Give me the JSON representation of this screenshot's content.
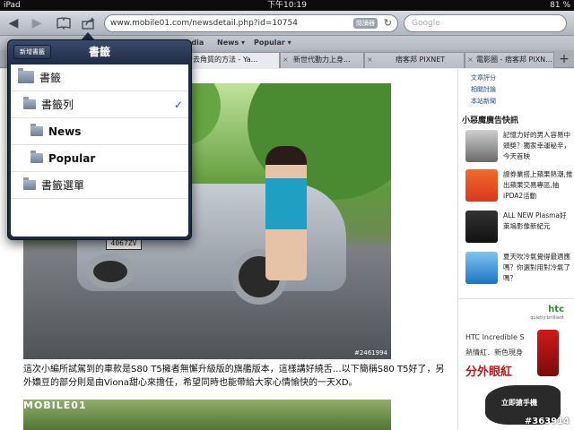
{
  "status": {
    "device": "iPad",
    "time": "下午10:19",
    "battery": "81 %"
  },
  "toolbar": {
    "back_icon": "back-arrow-icon",
    "forward_icon": "forward-arrow-icon",
    "bookmarks_icon": "book-icon",
    "share_icon": "share-icon",
    "url": "www.mobile01.com/newsdetail.php?id=10754",
    "reader_label": "閱讀器",
    "search_placeholder": "Google"
  },
  "bookmarks_bar": {
    "items": [
      "edia",
      "News ▾",
      "Popular ▾"
    ]
  },
  "tabs": [
    {
      "label": "去角質的方法 - Ya..."
    },
    {
      "label": "新世代動力上身..."
    },
    {
      "label": "痞客邦 PIXNET"
    },
    {
      "label": "電影圈 - 痞客邦 PIXN..."
    }
  ],
  "tab_add": "+",
  "popover": {
    "title": "書籤",
    "new_button": "新增書籤",
    "items": [
      {
        "label": "書籤",
        "checked": false
      },
      {
        "label": "書籤列",
        "checked": true
      },
      {
        "label": "News",
        "checked": false
      },
      {
        "label": "Popular",
        "checked": false
      },
      {
        "label": "書籤選單",
        "checked": false
      }
    ],
    "check_mark": "✓"
  },
  "article": {
    "plate": "4067ZV",
    "photo_id": "#2461994",
    "caption": "這次小編所試駕到的車款是S80 T5擁者無懈升級版的旗艦版本，這樣講好繞舌…以下簡稱S80 T5好了，另外嬝豆的部分則是由Viona甜心來擔任，希望同時也能帶給大家心情愉快的一天XD。",
    "logo_text": "MOBILE01"
  },
  "sidebar": {
    "links": [
      "文章評分",
      "相關討論",
      "本站新聞"
    ],
    "ad_heading": "小惡魔廣告快訊",
    "ads": [
      {
        "text": "記憶力好的男人容易中頭獎？獨家幸運秘辛，今天首映"
      },
      {
        "text": "證券業搭上蘋果熱潮,推出蘋果交易專區,抽iPDA2活動"
      },
      {
        "text": "ALL NEW Plasma好萊塢影像新紀元"
      },
      {
        "text": "夏天吹冷氣覺得最適應嗎？你選對用對冷氣了嗎？"
      }
    ],
    "htc": {
      "brand": "htc",
      "tagline": "quietly brilliant",
      "product": "HTC Incredible S",
      "line1": "熱情紅．新色現身",
      "line2": "分外眼紅",
      "cta": "立即搶手機"
    },
    "watermark": "#363914"
  }
}
